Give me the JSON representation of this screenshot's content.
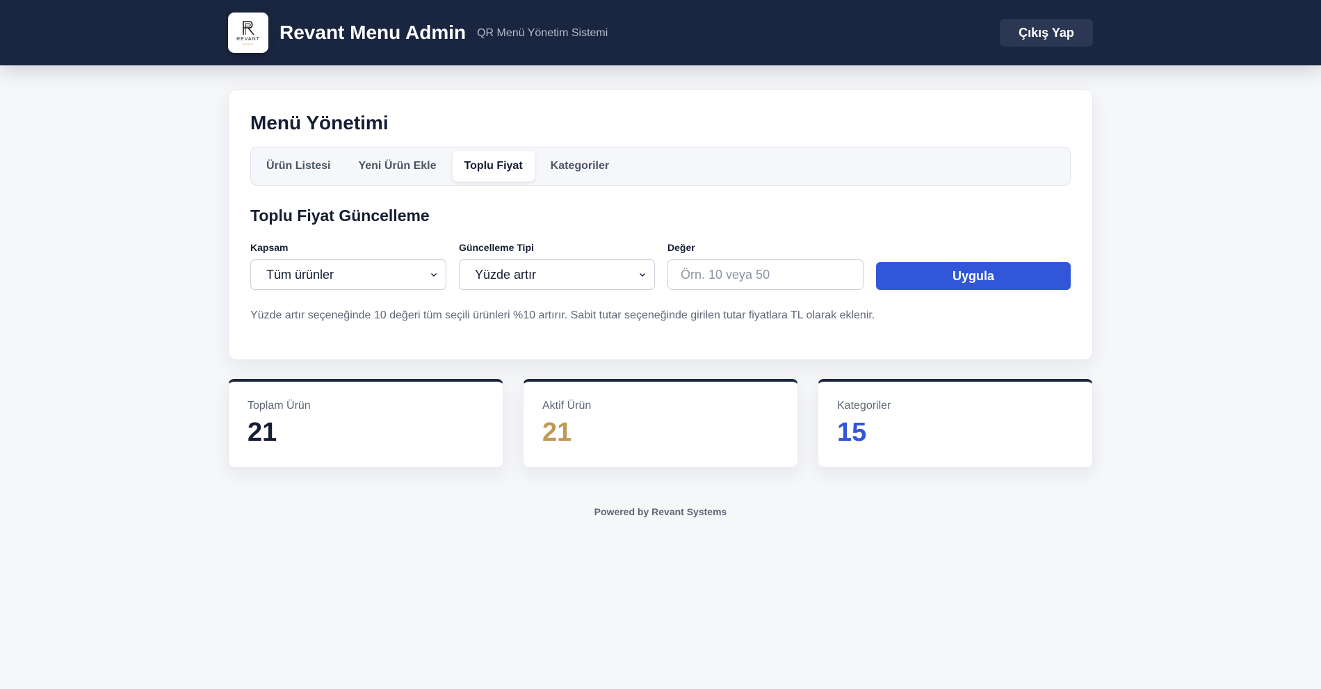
{
  "header": {
    "logo_text": "REVANT",
    "logo_sub": "MENU",
    "title": "Revant Menu Admin",
    "subtitle": "QR Menü Yönetim Sistemi",
    "logout_label": "Çıkış Yap"
  },
  "main": {
    "title": "Menü Yönetimi",
    "tabs": [
      {
        "label": "Ürün Listesi",
        "active": false
      },
      {
        "label": "Yeni Ürün Ekle",
        "active": false
      },
      {
        "label": "Toplu Fiyat",
        "active": true
      },
      {
        "label": "Kategoriler",
        "active": false
      }
    ],
    "section_title": "Toplu Fiyat Güncelleme",
    "form": {
      "scope_label": "Kapsam",
      "scope_value": "Tüm ürünler",
      "type_label": "Güncelleme Tipi",
      "type_value": "Yüzde artır",
      "value_label": "Değer",
      "value_placeholder": "Örn. 10 veya 50",
      "value_current": "",
      "apply_label": "Uygula"
    },
    "help_text": "Yüzde artır seçeneğinde 10 değeri tüm seçili ürünleri %10 artırır. Sabit tutar seçeneğinde girilen tutar fiyatlara TL olarak eklenir."
  },
  "stats": [
    {
      "label": "Toplam Ürün",
      "value": "21",
      "color": "#141d33"
    },
    {
      "label": "Aktif Ürün",
      "value": "21",
      "color": "#bf9a55"
    },
    {
      "label": "Kategoriler",
      "value": "15",
      "color": "#3157d8"
    }
  ],
  "footer": {
    "text": "Powered by Revant Systems"
  },
  "colors": {
    "navbar": "#1a2540",
    "accent": "#3157d8",
    "gold": "#bf9a55"
  }
}
